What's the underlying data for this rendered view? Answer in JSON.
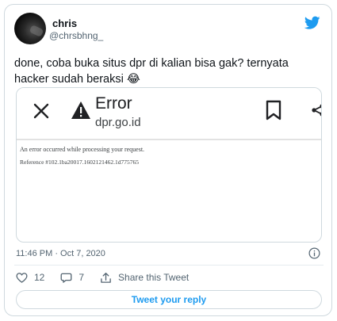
{
  "author": {
    "name": "chris",
    "handle": "@chrsbhng_"
  },
  "tweet": {
    "text": "done, coba buka situs dpr di kalian bisa gak? ternyata hacker sudah beraksi 😂",
    "timestamp": "11:46 PM · Oct 7, 2020"
  },
  "media": {
    "error_title": "Error",
    "error_url": "dpr.go.id",
    "error_message": "An error occurred while processing your request.",
    "error_reference": "Reference #102.1ba20017.1602121462.1d775765"
  },
  "actions": {
    "likes": "12",
    "replies": "7",
    "share_label": "Share this Tweet"
  },
  "reply_button": {
    "label": "Tweet your reply"
  },
  "colors": {
    "accent": "#1d9bf0",
    "border": "#cfd9de",
    "muted_text": "#536471"
  },
  "icons": [
    "twitter-bird-icon",
    "close-icon",
    "warning-icon",
    "bookmark-icon",
    "share-icon",
    "info-icon",
    "heart-icon",
    "comment-icon",
    "share-tweet-icon"
  ]
}
